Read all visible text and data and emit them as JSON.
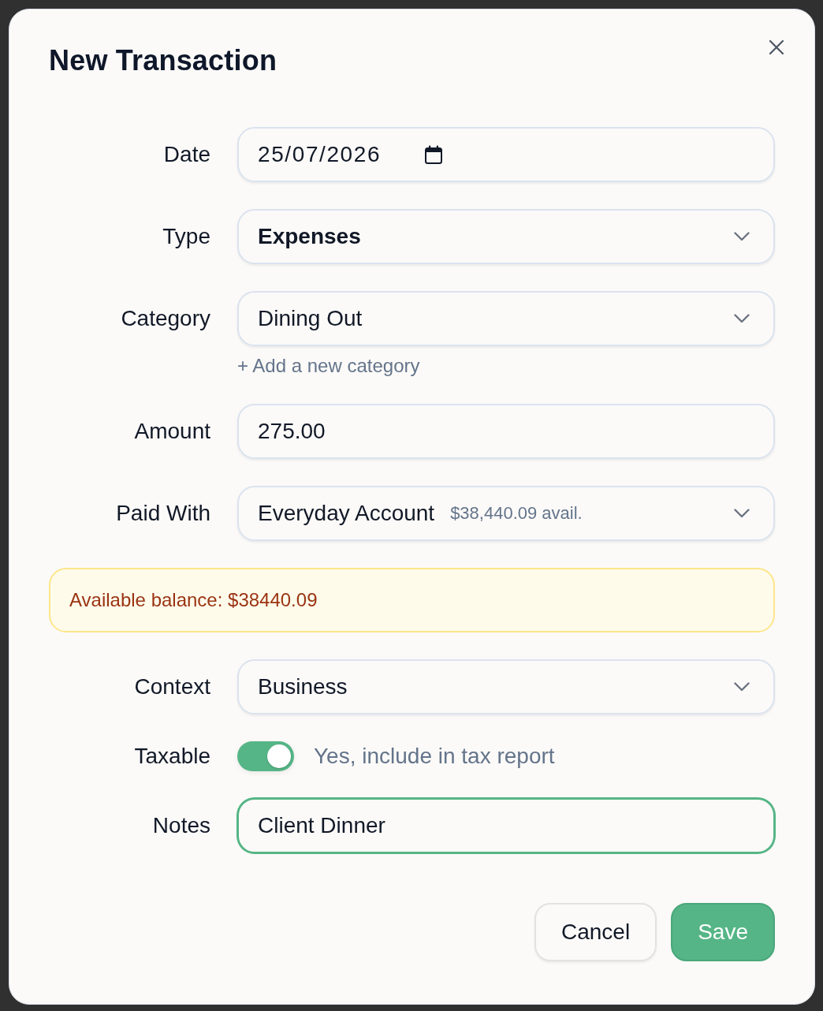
{
  "dialog": {
    "title": "New Transaction"
  },
  "form": [
    {
      "kind": "date",
      "label": "Date",
      "value": "25/07/2026",
      "emphasis": false,
      "focused": false
    },
    {
      "kind": "select",
      "label": "Type",
      "value": "Expenses",
      "emphasis": true,
      "focused": false
    },
    {
      "kind": "select",
      "label": "Category",
      "value": "Dining Out",
      "emphasis": false,
      "focused": false,
      "link": "+ Add a new category"
    },
    {
      "kind": "text",
      "label": "Amount",
      "value": "275.00",
      "emphasis": false,
      "focused": false
    },
    {
      "kind": "select",
      "label": "Paid With",
      "value": "Everyday Account",
      "hint": "$38,440.09 avail.",
      "emphasis": false,
      "focused": false
    },
    {
      "kind": "alert",
      "text": "Available balance: $38440.09"
    },
    {
      "kind": "select",
      "label": "Context",
      "value": "Business",
      "emphasis": false,
      "focused": false
    },
    {
      "kind": "toggle",
      "label": "Taxable",
      "on": true,
      "caption": "Yes, include in tax report"
    },
    {
      "kind": "text",
      "label": "Notes",
      "value": "Client Dinner",
      "emphasis": false,
      "focused": true
    }
  ],
  "buttons": [
    {
      "kind": "secondary",
      "label": "Cancel"
    },
    {
      "kind": "primary",
      "label": "Save"
    }
  ]
}
